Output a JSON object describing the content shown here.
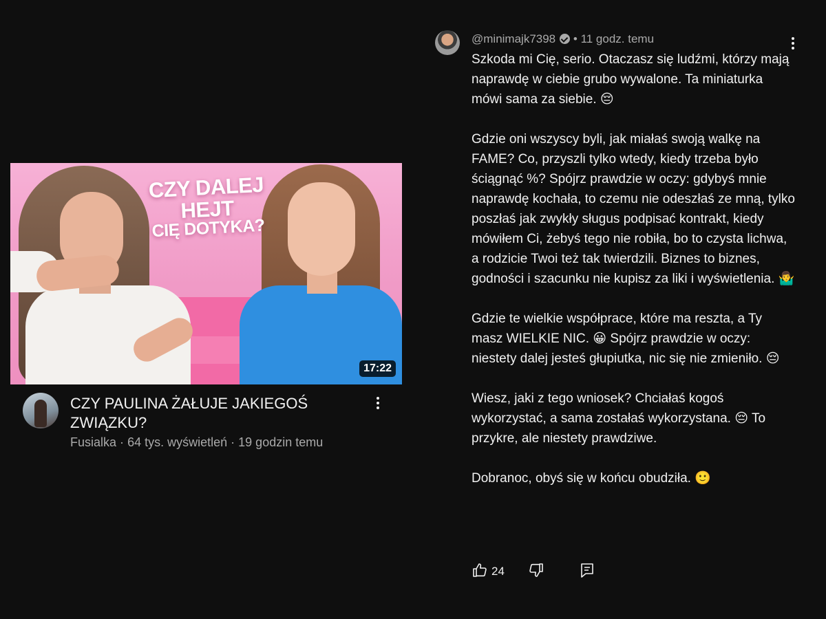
{
  "video": {
    "thumbnail_text_line1": "CZY DALEJ HEJT",
    "thumbnail_text_line2": "CIĘ DOTYKA?",
    "duration": "17:22",
    "title": "CZY PAULINA ŻAŁUJE JAKIEGOŚ ZWIĄZKU?",
    "channel": "Fusialka",
    "views": "64 tys. wyświetleń",
    "age": "19 godzin temu",
    "meta_separator": "·"
  },
  "comment": {
    "author": "@minimajk7398",
    "time_separator": "•",
    "time": "11 godz. temu",
    "paragraphs": [
      "Szkoda mi Cię, serio. Otaczasz się ludźmi, którzy mają naprawdę w ciebie grubo wywalone. Ta miniaturka mówi sama za siebie. 😔",
      "Gdzie oni wszyscy byli, jak miałaś swoją walkę na FAME? Co, przyszli tylko wtedy, kiedy trzeba było ściągnąć %? Spójrz prawdzie w oczy: gdybyś mnie naprawdę kochała, to czemu nie odeszłaś ze mną, tylko poszłaś jak zwykły sługus podpisać kontrakt, kiedy mówiłem Ci, żebyś tego nie robiła, bo to czysta lichwa, a rodzicie Twoi też tak twierdzili. Biznes to biznes, godności i szacunku nie kupisz za liki i wyświetlenia. 🤷‍♂️",
      "Gdzie te wielkie współprace, które ma reszta, a Ty masz WIELKIE NIC. 😀 Spójrz prawdzie w oczy: niestety dalej jesteś głupiutka, nic się nie zmieniło. 😔",
      "Wiesz, jaki z tego wniosek? Chciałaś kogoś wykorzystać, a sama zostałaś wykorzystana. 😔 To przykre, ale niestety prawdziwe.",
      "Dobranoc, obyś się w końcu obudziła. 🙂"
    ],
    "likes": "24"
  },
  "icons": {
    "like": "thumbs-up-icon",
    "dislike": "thumbs-down-icon",
    "reply": "reply-icon",
    "more": "more-vert-icon",
    "verified": "verified-icon"
  },
  "colors": {
    "background": "#0f0f0f",
    "text_primary": "#f1f1f1",
    "text_secondary": "#aaaaaa",
    "thumbnail_pink": "#f19ac8"
  }
}
